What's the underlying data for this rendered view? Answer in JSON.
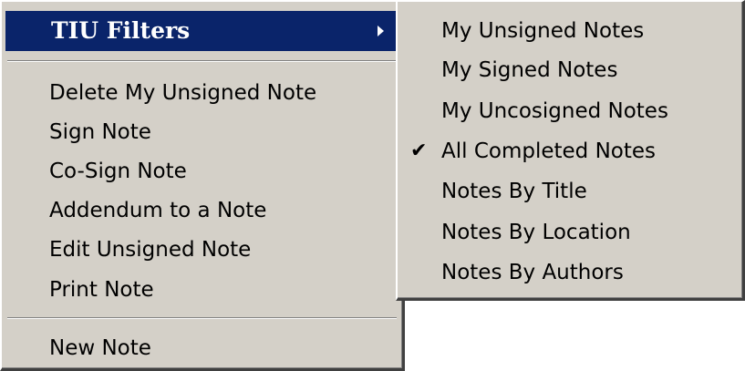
{
  "main_menu": {
    "highlighted": {
      "label": "TIU Filters",
      "icon": "submenu-arrow-icon"
    },
    "items": [
      {
        "label": "Delete My Unsigned Note"
      },
      {
        "label": "Sign Note"
      },
      {
        "label": "Co-Sign Note"
      },
      {
        "label": "Addendum to a Note"
      },
      {
        "label": "Edit Unsigned Note"
      },
      {
        "label": "Print Note"
      },
      {
        "label": "New Note"
      }
    ]
  },
  "submenu": {
    "items": [
      {
        "label": "My Unsigned Notes",
        "checked": false
      },
      {
        "label": "My Signed Notes",
        "checked": false
      },
      {
        "label": "My Uncosigned Notes",
        "checked": false
      },
      {
        "label": "All Completed Notes",
        "checked": true,
        "check_glyph": "✔"
      },
      {
        "label": "Notes By Title",
        "checked": false
      },
      {
        "label": "Notes By Location",
        "checked": false
      },
      {
        "label": "Notes By Authors",
        "checked": false
      }
    ]
  },
  "colors": {
    "menu_bg": "#d4d0c8",
    "highlight_bg": "#0a246a",
    "highlight_text": "#ffffff",
    "text": "#000000"
  }
}
